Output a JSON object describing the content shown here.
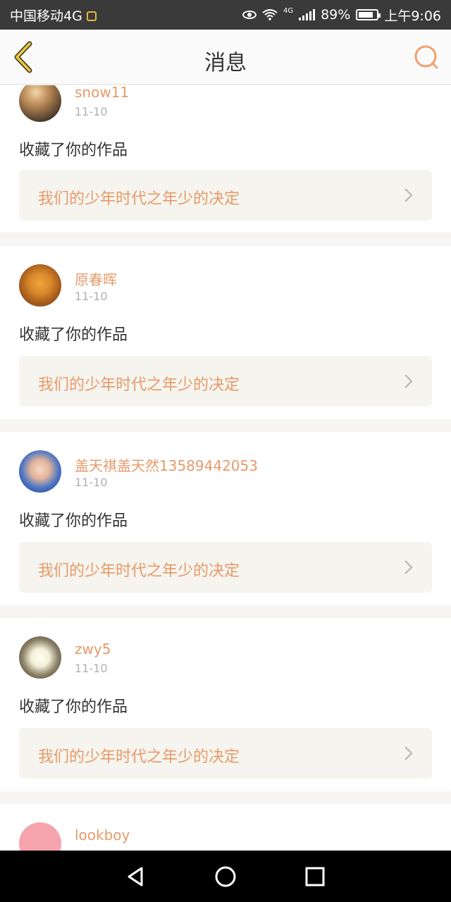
{
  "status_bar": {
    "carrier": "中国移动4G",
    "network_label": "4G",
    "battery_percent": "89%",
    "time": "上午9:06"
  },
  "header": {
    "title": "消息",
    "back_icon": "chevron-left-icon",
    "search_icon": "search-icon"
  },
  "messages": [
    {
      "username": "snow11",
      "date": "11-10",
      "action": "收藏了你的作品",
      "work_title": "我们的少年时代之年少的决定",
      "avatar": "sunset-avatar"
    },
    {
      "username": "原春晖",
      "date": "11-10",
      "action": "收藏了你的作品",
      "work_title": "我们的少年时代之年少的决定",
      "avatar": "autumn-tree-avatar"
    },
    {
      "username": "盖天祺盖天然13589442053",
      "date": "11-10",
      "action": "收藏了你的作品",
      "work_title": "我们的少年时代之年少的决定",
      "avatar": "girl-avatar"
    },
    {
      "username": "zwy5",
      "date": "11-10",
      "action": "收藏了你的作品",
      "work_title": "我们的少年时代之年少的决定",
      "avatar": "flower-avatar"
    },
    {
      "username": "lookboy",
      "date": "",
      "action": "",
      "work_title": "",
      "avatar": "pink-avatar"
    }
  ],
  "colors": {
    "accent": "#e79a6a",
    "back_icon": "#e9b43c",
    "card_bg": "#ffffff",
    "work_bg": "#f5f4ee"
  },
  "nav": {
    "back": "triangle-back-icon",
    "home": "circle-home-icon",
    "recents": "square-recents-icon"
  }
}
